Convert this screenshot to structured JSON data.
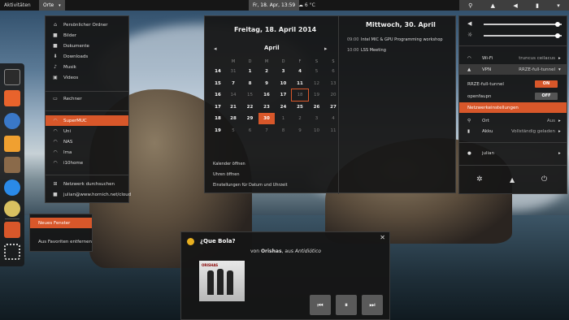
{
  "topbar": {
    "activities": "Aktivitäten",
    "places": "Orte",
    "clock": "Fr, 18. Apr, 13:59",
    "weather": "6 °C"
  },
  "places_menu": {
    "items": [
      {
        "label": "Persönlicher Ordner",
        "icon": "home-icon"
      },
      {
        "label": "Bilder",
        "icon": "folder-icon"
      },
      {
        "label": "Dokumente",
        "icon": "folder-icon"
      },
      {
        "label": "Downloads",
        "icon": "download-icon"
      },
      {
        "label": "Musik",
        "icon": "music-icon"
      },
      {
        "label": "Videos",
        "icon": "video-icon"
      }
    ],
    "computer": "Rechner",
    "networks": [
      {
        "label": "SuperMUC",
        "selected": true
      },
      {
        "label": "Uni",
        "selected": false
      },
      {
        "label": "NAS",
        "selected": false
      },
      {
        "label": "Ima",
        "selected": false
      },
      {
        "label": "i10home",
        "selected": false
      }
    ],
    "browse": "Netzwerk durchsuchen",
    "cloud": "julian@www.hornich.net/cloud"
  },
  "calendar": {
    "date_title": "Freitag, 18. April 2014",
    "month": "April",
    "weekdays": [
      "M",
      "D",
      "M",
      "D",
      "F",
      "S",
      "S"
    ],
    "weeks": [
      {
        "wk": "14",
        "days": [
          {
            "d": "31",
            "dim": true
          },
          {
            "d": "1"
          },
          {
            "d": "2"
          },
          {
            "d": "3"
          },
          {
            "d": "4"
          },
          {
            "d": "5",
            "dim": true
          },
          {
            "d": "6",
            "dim": true
          }
        ]
      },
      {
        "wk": "15",
        "days": [
          {
            "d": "7"
          },
          {
            "d": "8"
          },
          {
            "d": "9"
          },
          {
            "d": "10"
          },
          {
            "d": "11"
          },
          {
            "d": "12",
            "dim": true
          },
          {
            "d": "13",
            "dim": true
          }
        ]
      },
      {
        "wk": "16",
        "days": [
          {
            "d": "14",
            "dim": true
          },
          {
            "d": "15",
            "dim": true
          },
          {
            "d": "16"
          },
          {
            "d": "17"
          },
          {
            "d": "18",
            "selected": true,
            "dim": true
          },
          {
            "d": "19",
            "dim": true
          },
          {
            "d": "20",
            "dim": true
          }
        ]
      },
      {
        "wk": "17",
        "days": [
          {
            "d": "21"
          },
          {
            "d": "22"
          },
          {
            "d": "23"
          },
          {
            "d": "24"
          },
          {
            "d": "25"
          },
          {
            "d": "26"
          },
          {
            "d": "27"
          }
        ]
      },
      {
        "wk": "18",
        "days": [
          {
            "d": "28"
          },
          {
            "d": "29"
          },
          {
            "d": "30",
            "today": true
          },
          {
            "d": "1",
            "dim": true
          },
          {
            "d": "2",
            "dim": true
          },
          {
            "d": "3",
            "dim": true
          },
          {
            "d": "4",
            "dim": true
          }
        ]
      },
      {
        "wk": "19",
        "days": [
          {
            "d": "5",
            "dim": true
          },
          {
            "d": "6",
            "dim": true
          },
          {
            "d": "7",
            "dim": true
          },
          {
            "d": "8",
            "dim": true
          },
          {
            "d": "9",
            "dim": true
          },
          {
            "d": "10",
            "dim": true
          },
          {
            "d": "11",
            "dim": true
          }
        ]
      }
    ],
    "links": [
      "Kalender öffnen",
      "Uhren öffnen",
      "Einstellungen für Datum und Uhrzeit"
    ],
    "events_day": "Mittwoch, 30. April",
    "events": [
      {
        "time": "09:00",
        "title": "Intel MIC & GPU Programming workshop"
      },
      {
        "time": "10:00",
        "title": "LSS Meeting"
      }
    ]
  },
  "system": {
    "volume_level": 0.95,
    "brightness_level": 0.95,
    "wifi_label": "Wi-Fi",
    "wifi_value": "truncus ceilacus",
    "vpn_label": "VPN",
    "vpn_value": "RRZE-full-tunnel",
    "vpn_rows": [
      {
        "label": "RRZE-full-tunnel",
        "state": "ON"
      },
      {
        "label": "openfaupn",
        "state": "OFF"
      }
    ],
    "net_settings": "Netzwerkeinstellungen",
    "location_label": "Ort",
    "location_value": "Aus",
    "battery_label": "Akku",
    "battery_value": "Vollständig geladen",
    "user": "julian"
  },
  "context_menu": {
    "items": [
      "Neues Fenster",
      "Aus Favoriten entfernen"
    ]
  },
  "notification": {
    "title": "¿Que Bola?",
    "by_prefix": "von ",
    "artist": "Orishas",
    "album_sep": ", aus ",
    "album": "Antidiótico",
    "cover_text": "ORISHAS"
  }
}
